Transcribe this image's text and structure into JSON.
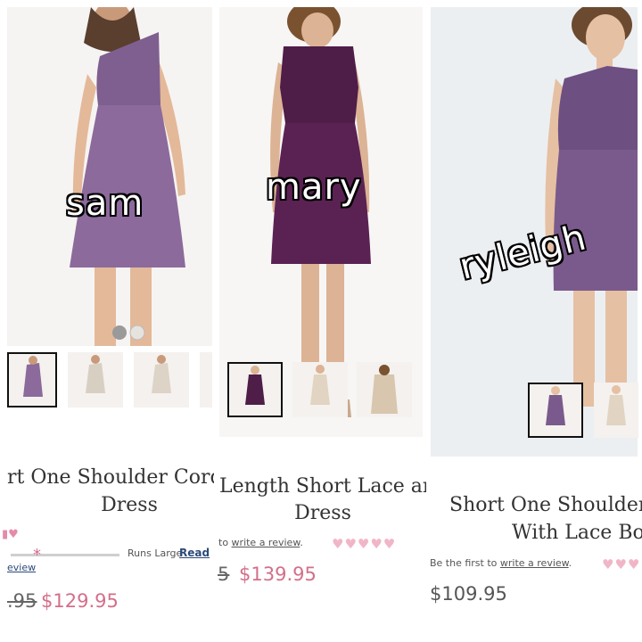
{
  "panels": [
    {
      "name_tag": "sam",
      "title_line1": "rt One Shoulder Cord",
      "title_line2": "Dress",
      "runs_large": "Runs Large",
      "read_link": "Read",
      "review_link": "eview",
      "old_price": ".95",
      "price": "$129.95",
      "dress_color": "#8c6a9c"
    },
    {
      "name_tag": "mary",
      "title_line1": "Length Short Lace and",
      "title_line2": "Dress",
      "review_text": "to ",
      "review_link": "write a review",
      "old_price": "5",
      "price": "$139.95",
      "dress_color": "#4e1d48"
    },
    {
      "name_tag": "ryleigh",
      "title_line1": "Short One Shoulder",
      "title_line2": "With Lace Bo",
      "review_text": "Be the first to ",
      "review_link": "write a review",
      "price": "$109.95",
      "dress_color": "#7a5a8c"
    }
  ],
  "colors": {
    "price_pink": "#d36f8a",
    "heart_pink": "#f0b6c8",
    "link_blue": "#2c4a7a"
  }
}
